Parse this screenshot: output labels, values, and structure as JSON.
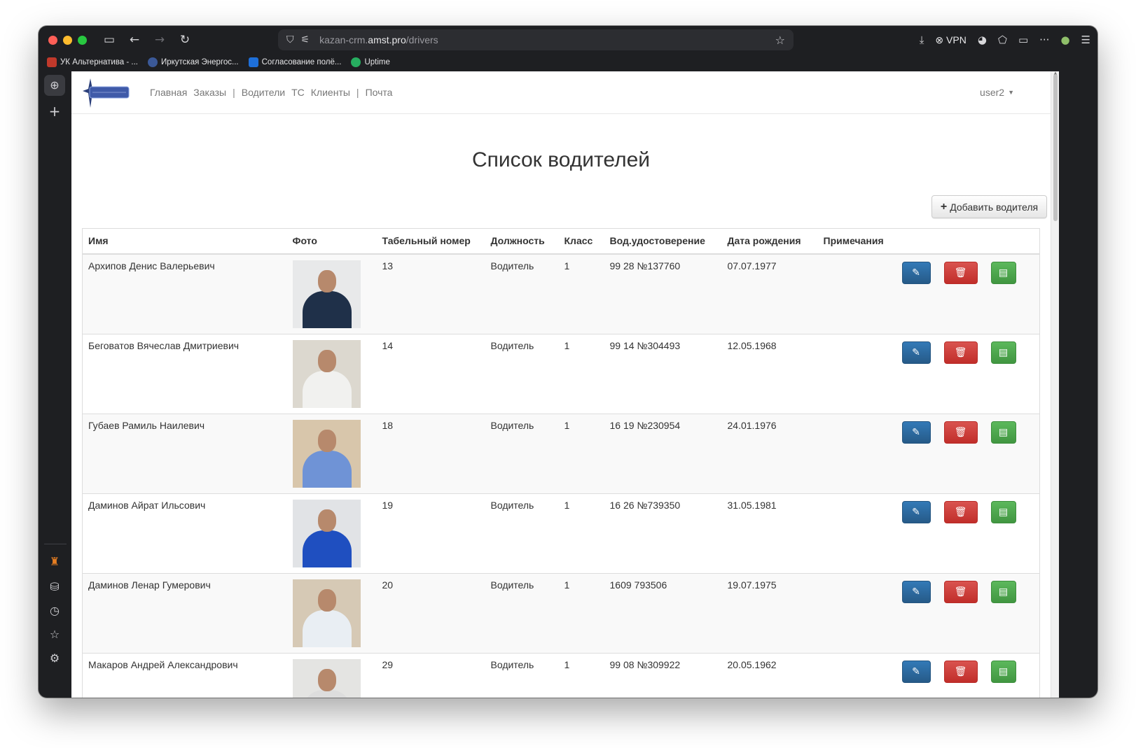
{
  "browser": {
    "url_prefix": "kazan-crm.",
    "url_domain": "amst.pro",
    "url_path": "/drivers",
    "vpn_label": "VPN",
    "bookmarks": [
      {
        "label": "УК Альтернатива - ...",
        "color": "#c0392b"
      },
      {
        "label": "Иркутская Энергос...",
        "color": "#3b5998"
      },
      {
        "label": "Согласование полё...",
        "color": "#1e6fd9"
      },
      {
        "label": "Uptime",
        "color": "#27ae60"
      }
    ]
  },
  "nav": {
    "logo_text": "Автовокзал Восточный",
    "links": [
      {
        "label": "Главная"
      },
      {
        "label": "Заказы"
      },
      {
        "label": "|"
      },
      {
        "label": "Водители"
      },
      {
        "label": "ТС"
      },
      {
        "label": "Клиенты"
      },
      {
        "label": "|"
      },
      {
        "label": "Почта"
      }
    ],
    "user": "user2"
  },
  "page": {
    "title": "Список водителей",
    "add_button": "Добавить водителя"
  },
  "table": {
    "headers": [
      "Имя",
      "Фото",
      "Табельный номер",
      "Должность",
      "Класс",
      "Вод.удостоверение",
      "Дата рождения",
      "Примечания",
      ""
    ],
    "rows": [
      {
        "name": "Архипов Денис Валерьевич",
        "tab": "13",
        "position": "Водитель",
        "class": "1",
        "license": "99 28 №137760",
        "birth": "07.07.1977",
        "notes": "",
        "shirt": "#1f3049",
        "bg": "#e8e9ea"
      },
      {
        "name": "Беговатов Вячеслав Дмитриевич",
        "tab": "14",
        "position": "Водитель",
        "class": "1",
        "license": "99 14 №304493",
        "birth": "12.05.1968",
        "notes": "",
        "shirt": "#f1f1ef",
        "bg": "#dcd8cf"
      },
      {
        "name": "Губаев Рамиль Наилевич",
        "tab": "18",
        "position": "Водитель",
        "class": "1",
        "license": "16 19 №230954",
        "birth": "24.01.1976",
        "notes": "",
        "shirt": "#6f93d6",
        "bg": "#d8c6ab"
      },
      {
        "name": "Даминов Айрат Ильсович",
        "tab": "19",
        "position": "Водитель",
        "class": "1",
        "license": "16 26 №739350",
        "birth": "31.05.1981",
        "notes": "",
        "shirt": "#1f4fc0",
        "bg": "#e1e3e6"
      },
      {
        "name": "Даминов Ленар Гумерович",
        "tab": "20",
        "position": "Водитель",
        "class": "1",
        "license": "1609 793506",
        "birth": "19.07.1975",
        "notes": "",
        "shirt": "#e9eef3",
        "bg": "#d6c9b5"
      },
      {
        "name": "Макаров Андрей Александрович",
        "tab": "29",
        "position": "Водитель",
        "class": "1",
        "license": "99 08 №309922",
        "birth": "20.05.1962",
        "notes": "",
        "shirt": "#dddddd",
        "bg": "#e4e4e2"
      }
    ]
  },
  "colors": {
    "edit": "#337ab7",
    "delete": "#d9534f",
    "doc": "#5cb85c"
  }
}
